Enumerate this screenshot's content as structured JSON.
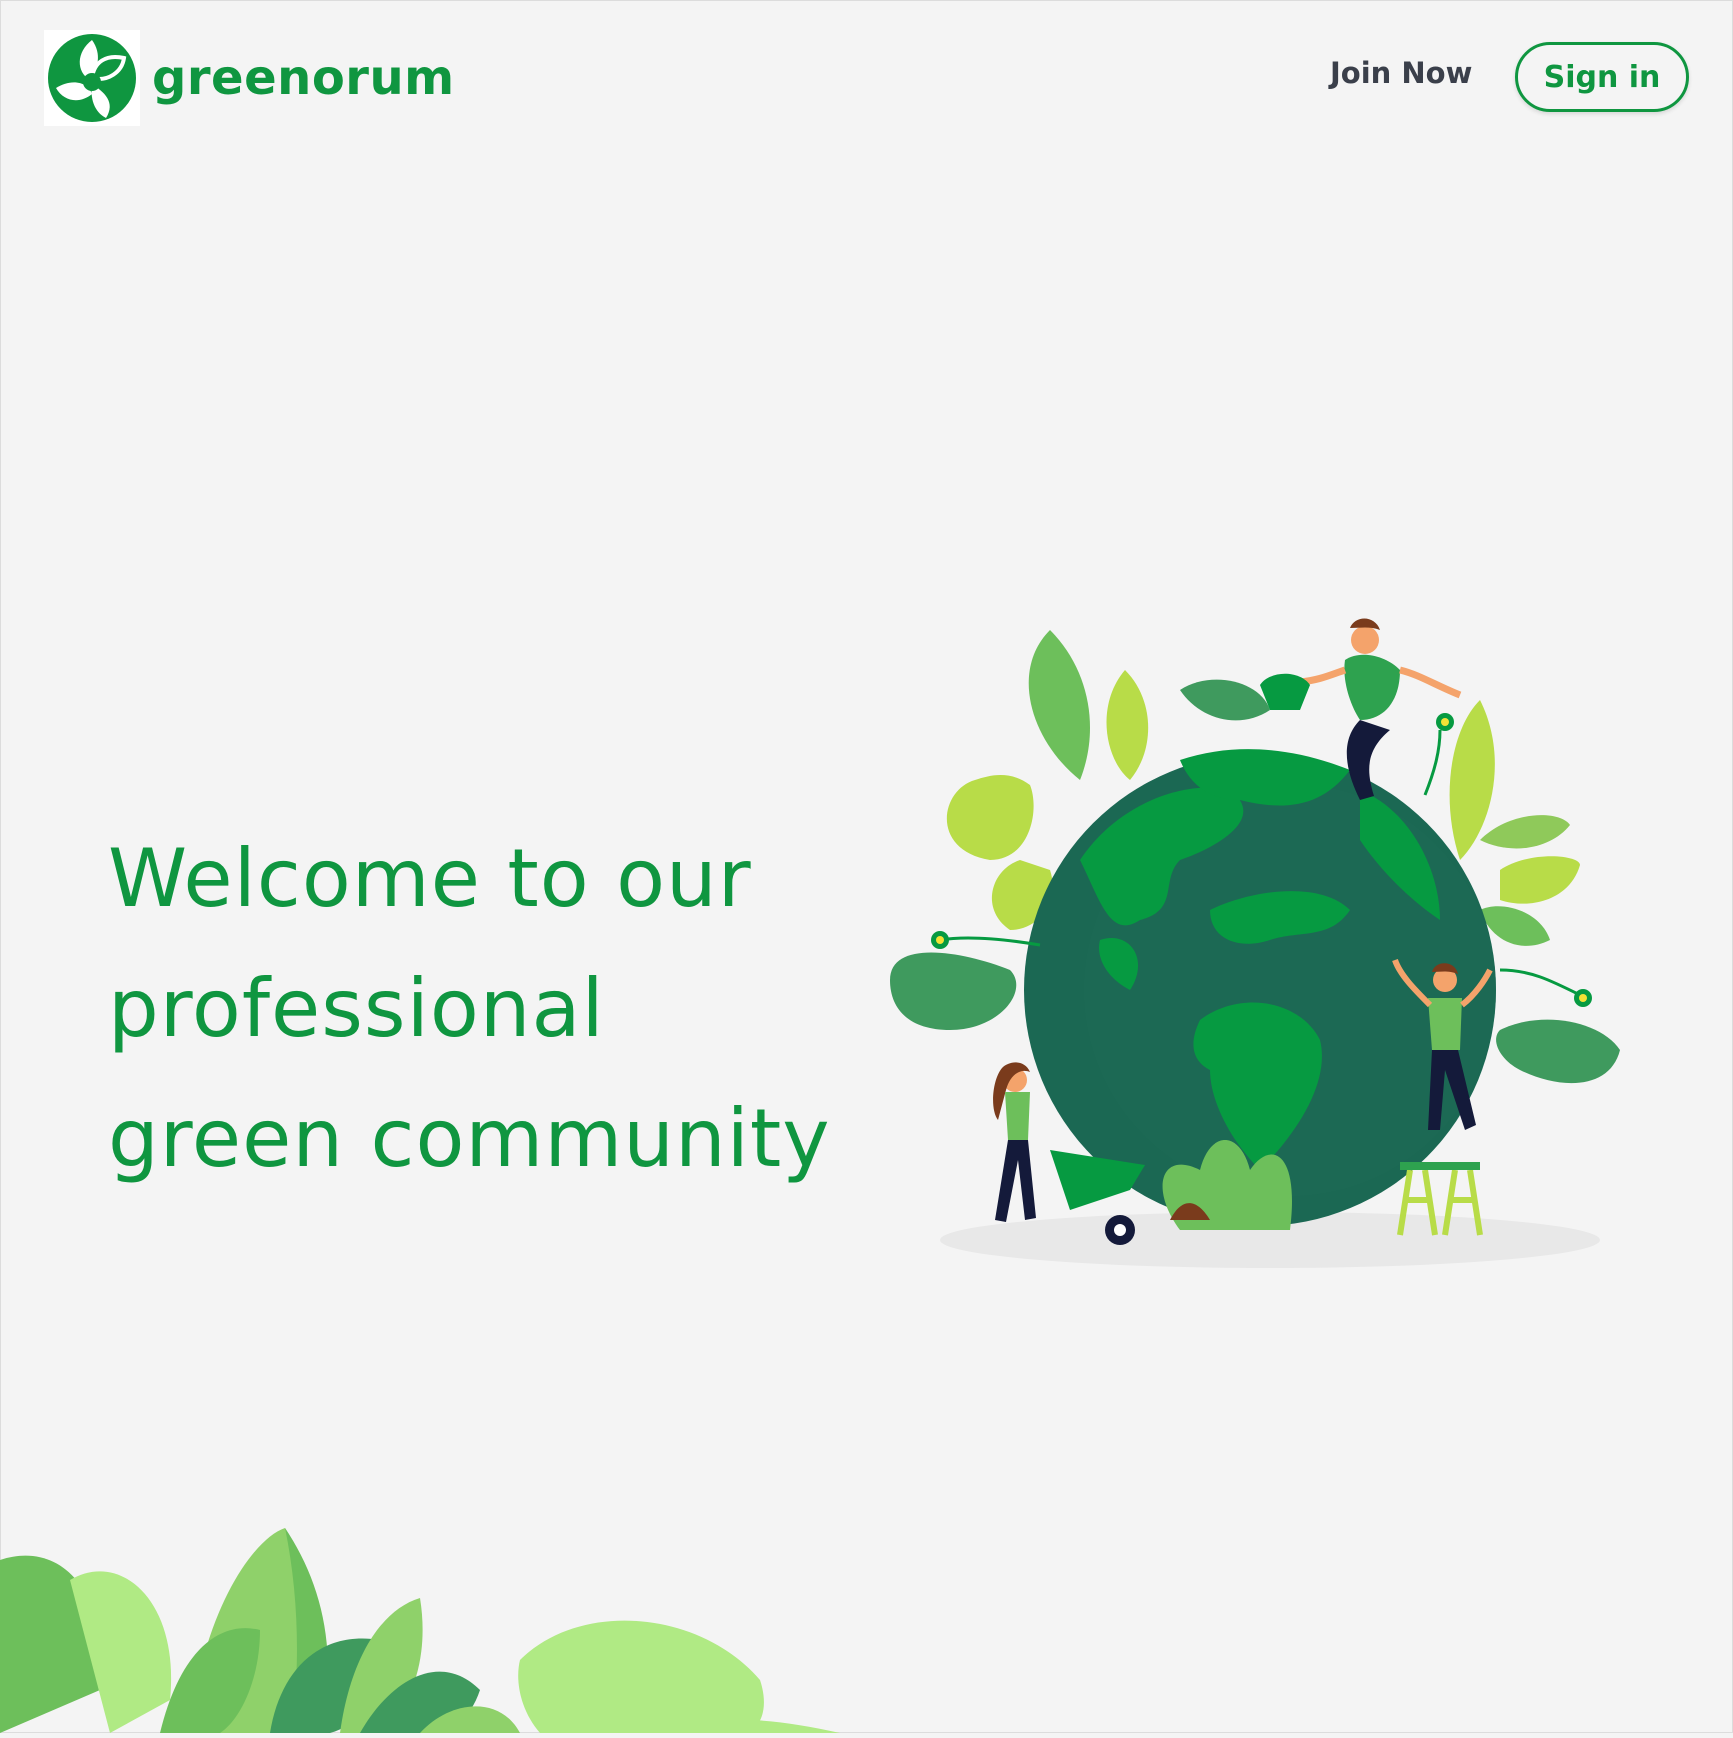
{
  "header": {
    "brand_name": "greenorum",
    "join_label": "Join Now",
    "signin_label": "Sign in"
  },
  "hero": {
    "title_lines": [
      "Welcome to our",
      "professional",
      "green community"
    ]
  },
  "colors": {
    "brand_green": "#0f9640",
    "background": "#f4f4f4",
    "nav_text": "#3a3f4a"
  },
  "icons": {
    "logo": "leaf-trefoil-icon",
    "illustration": "globe-with-gardeners-illustration",
    "footer": "leaves-decoration"
  }
}
